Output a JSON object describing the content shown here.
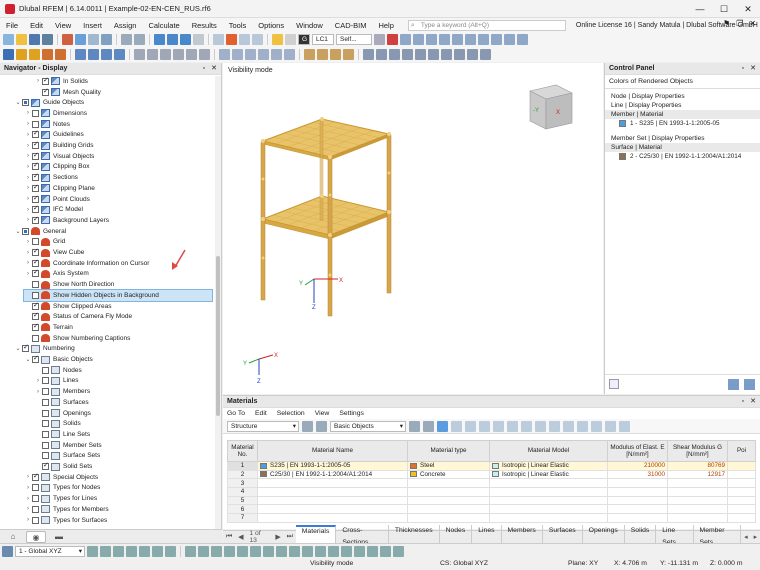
{
  "window": {
    "title": "Dlubal RFEM | 6.14.0011 | Example-02-EN-CEN_RUS.rf6",
    "controls": [
      "—",
      "☐",
      "✕"
    ]
  },
  "menu": {
    "items": [
      "File",
      "Edit",
      "View",
      "Insert",
      "Assign",
      "Calculate",
      "Results",
      "Tools",
      "Options",
      "Window",
      "CAD-BIM",
      "Help"
    ],
    "search_placeholder": "Type a keyword (Alt+Q)",
    "license": "Online License 16 | Sandy Matula | Dlubal Software GmbH"
  },
  "toolbar": {
    "load_case_badge": "G",
    "load_case": "LC1",
    "load_case_name": "Self..."
  },
  "navigator": {
    "title": "Navigator - Display",
    "items": [
      {
        "label": "In Solids",
        "level": 2,
        "exp": ">",
        "check": "checked",
        "icon": "obj"
      },
      {
        "label": "Mesh Quality",
        "level": 2,
        "exp": "",
        "check": "checked",
        "icon": "obj"
      },
      {
        "label": "Guide Objects",
        "level": 0,
        "exp": "v",
        "check": "partial",
        "icon": "obj"
      },
      {
        "label": "Dimensions",
        "level": 1,
        "exp": ">",
        "check": "empty",
        "icon": "obj"
      },
      {
        "label": "Notes",
        "level": 1,
        "exp": ">",
        "check": "empty",
        "icon": "obj"
      },
      {
        "label": "Guidelines",
        "level": 1,
        "exp": ">",
        "check": "checked",
        "icon": "obj"
      },
      {
        "label": "Building Grids",
        "level": 1,
        "exp": ">",
        "check": "checked",
        "icon": "obj"
      },
      {
        "label": "Visual Objects",
        "level": 1,
        "exp": ">",
        "check": "checked",
        "icon": "obj"
      },
      {
        "label": "Clipping Box",
        "level": 1,
        "exp": ">",
        "check": "checked",
        "icon": "obj"
      },
      {
        "label": "Sections",
        "level": 1,
        "exp": ">",
        "check": "checked",
        "icon": "obj"
      },
      {
        "label": "Clipping Plane",
        "level": 1,
        "exp": ">",
        "check": "checked",
        "icon": "obj"
      },
      {
        "label": "Point Clouds",
        "level": 1,
        "exp": ">",
        "check": "checked",
        "icon": "obj"
      },
      {
        "label": "IFC Model",
        "level": 1,
        "exp": ">",
        "check": "checked",
        "icon": "obj"
      },
      {
        "label": "Background Layers",
        "level": 1,
        "exp": ">",
        "check": "checked",
        "icon": "obj"
      },
      {
        "label": "General",
        "level": 0,
        "exp": "v",
        "check": "partial",
        "icon": "gen"
      },
      {
        "label": "Grid",
        "level": 1,
        "exp": ">",
        "check": "empty",
        "icon": "gen"
      },
      {
        "label": "View Cube",
        "level": 1,
        "exp": ">",
        "check": "checked",
        "icon": "gen"
      },
      {
        "label": "Coordinate Information on Cursor",
        "level": 1,
        "exp": ">",
        "check": "checked",
        "icon": "gen"
      },
      {
        "label": "Axis System",
        "level": 1,
        "exp": ">",
        "check": "checked",
        "icon": "gen"
      },
      {
        "label": "Show North Direction",
        "level": 1,
        "exp": "",
        "check": "empty",
        "icon": "gen"
      },
      {
        "label": "Show Hidden Objects in Background",
        "level": 1,
        "exp": "",
        "check": "empty",
        "icon": "gen",
        "selected": true
      },
      {
        "label": "Show Clipped Areas",
        "level": 1,
        "exp": "",
        "check": "checked",
        "icon": "gen"
      },
      {
        "label": "Status of Camera Fly Mode",
        "level": 1,
        "exp": "",
        "check": "checked",
        "icon": "gen"
      },
      {
        "label": "Terrain",
        "level": 1,
        "exp": "",
        "check": "checked",
        "icon": "gen"
      },
      {
        "label": "Show Numbering Captions",
        "level": 1,
        "exp": "",
        "check": "empty",
        "icon": "gen"
      },
      {
        "label": "Numbering",
        "level": 0,
        "exp": "v",
        "check": "checked",
        "icon": "num"
      },
      {
        "label": "Basic Objects",
        "level": 1,
        "exp": "v",
        "check": "checked",
        "icon": "num"
      },
      {
        "label": "Nodes",
        "level": 2,
        "exp": "",
        "check": "empty",
        "icon": "num"
      },
      {
        "label": "Lines",
        "level": 2,
        "exp": ">",
        "check": "empty",
        "icon": "num"
      },
      {
        "label": "Members",
        "level": 2,
        "exp": ">",
        "check": "empty",
        "icon": "num"
      },
      {
        "label": "Surfaces",
        "level": 2,
        "exp": "",
        "check": "empty",
        "icon": "num"
      },
      {
        "label": "Openings",
        "level": 2,
        "exp": "",
        "check": "empty",
        "icon": "num"
      },
      {
        "label": "Solids",
        "level": 2,
        "exp": "",
        "check": "empty",
        "icon": "num"
      },
      {
        "label": "Line Sets",
        "level": 2,
        "exp": "",
        "check": "empty",
        "icon": "num"
      },
      {
        "label": "Member Sets",
        "level": 2,
        "exp": "",
        "check": "empty",
        "icon": "num"
      },
      {
        "label": "Surface Sets",
        "level": 2,
        "exp": "",
        "check": "empty",
        "icon": "num"
      },
      {
        "label": "Solid Sets",
        "level": 2,
        "exp": "",
        "check": "checked",
        "icon": "num"
      },
      {
        "label": "Special Objects",
        "level": 1,
        "exp": ">",
        "check": "checked",
        "icon": "num"
      },
      {
        "label": "Types for Nodes",
        "level": 1,
        "exp": ">",
        "check": "empty",
        "icon": "num"
      },
      {
        "label": "Types for Lines",
        "level": 1,
        "exp": ">",
        "check": "empty",
        "icon": "num"
      },
      {
        "label": "Types for Members",
        "level": 1,
        "exp": ">",
        "check": "empty",
        "icon": "num"
      },
      {
        "label": "Types for Surfaces",
        "level": 1,
        "exp": ">",
        "check": "empty",
        "icon": "num"
      }
    ]
  },
  "viewport": {
    "mode": "Visibility mode",
    "axis_x": "X",
    "axis_y": "Y",
    "axis_z": "Z",
    "cube_y": "-Y",
    "cube_x": "X"
  },
  "control_panel": {
    "title": "Control Panel",
    "subtitle": "Colors of Rendered Objects",
    "groups": [
      {
        "header": "Node | Display Properties",
        "items": []
      },
      {
        "header": "Line | Display Properties",
        "items": []
      },
      {
        "header": "Member | Material",
        "items": [
          {
            "label": "1 - S235 | EN 1993-1-1:2005-05",
            "color": "#4a9fe0"
          }
        ]
      },
      {
        "header": "Member Set | Display Properties",
        "items": []
      },
      {
        "header": "Surface | Material",
        "items": [
          {
            "label": "2 - C25/30 | EN 1992-1-1:2004/A1:2014",
            "color": "#8b7355"
          }
        ]
      }
    ]
  },
  "materials": {
    "title": "Materials",
    "menu": [
      "Go To",
      "Edit",
      "Selection",
      "View",
      "Settings"
    ],
    "structure_combo": "Structure",
    "basic_objects_combo": "Basic Objects",
    "columns": [
      "Material No.",
      "Material Name",
      "Material type",
      "Material Model",
      "Modulus of Elast. E [N/mm²]",
      "Shear Modulus G [N/mm²]",
      "Poi"
    ],
    "rows": [
      {
        "no": "1",
        "name": "S235 | EN 1993-1-1:2005-05",
        "name_color": "#4a9fe0",
        "type": "Steel",
        "type_color": "#e07030",
        "model": "Isotropic | Linear Elastic",
        "model_color": "#c8f0f4",
        "e": "210000",
        "g": "80769"
      },
      {
        "no": "2",
        "name": "C25/30 | EN 1992-1-1:2004/A1:2014",
        "name_color": "#8b7355",
        "type": "Concrete",
        "type_color": "#f0c020",
        "model": "Isotropic | Linear Elastic",
        "model_color": "#c8f0f4",
        "e": "31000",
        "g": "12917"
      },
      {
        "no": "3",
        "name": "",
        "type": "",
        "model": "",
        "e": "",
        "g": ""
      },
      {
        "no": "4",
        "name": "",
        "type": "",
        "model": "",
        "e": "",
        "g": ""
      },
      {
        "no": "5",
        "name": "",
        "type": "",
        "model": "",
        "e": "",
        "g": ""
      },
      {
        "no": "6",
        "name": "",
        "type": "",
        "model": "",
        "e": "",
        "g": ""
      },
      {
        "no": "7",
        "name": "",
        "type": "",
        "model": "",
        "e": "",
        "g": ""
      }
    ],
    "pager": "1 of 13",
    "tabs": [
      "Materials",
      "Cross-Sections",
      "Thicknesses",
      "Nodes",
      "Lines",
      "Members",
      "Surfaces",
      "Openings",
      "Solids",
      "Line Sets",
      "Member Sets"
    ]
  },
  "statusbar": {
    "coord_system": "1 - Global XYZ",
    "mode": "Visibility mode",
    "cs": "CS: Global XYZ",
    "plane": "Plane: XY",
    "x": "X: 4.706 m",
    "y": "Y: -11.131 m",
    "z": "Z: 0.000 m"
  },
  "colors": {
    "member": "#e3a93a",
    "slab": "#e8c36a",
    "accent": "#3a7bd5"
  }
}
